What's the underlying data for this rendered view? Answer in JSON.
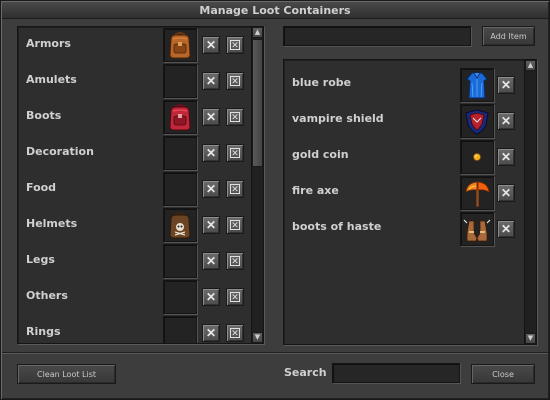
{
  "window": {
    "title": "Manage Loot Containers"
  },
  "categories": [
    {
      "label": "Armors",
      "container": "orange-backpack"
    },
    {
      "label": "Amulets",
      "container": ""
    },
    {
      "label": "Boots",
      "container": "red-backpack"
    },
    {
      "label": "Decoration",
      "container": ""
    },
    {
      "label": "Food",
      "container": ""
    },
    {
      "label": "Helmets",
      "container": "pirate-backpack"
    },
    {
      "label": "Legs",
      "container": ""
    },
    {
      "label": "Others",
      "container": ""
    },
    {
      "label": "Rings",
      "container": ""
    }
  ],
  "top": {
    "item_input_value": "",
    "add_item_label": "Add Item"
  },
  "loot_items": [
    {
      "label": "blue robe",
      "icon": "blue-robe-icon"
    },
    {
      "label": "vampire shield",
      "icon": "vampire-shield-icon"
    },
    {
      "label": "gold coin",
      "icon": "gold-coin-icon"
    },
    {
      "label": "fire axe",
      "icon": "fire-axe-icon"
    },
    {
      "label": "boots of haste",
      "icon": "boots-of-haste-icon"
    }
  ],
  "bottom": {
    "clean_label": "Clean Loot List",
    "search_label": "Search",
    "search_value": "",
    "close_label": "Close"
  },
  "colors": {
    "window_bg": "#3d3d3d",
    "panel_bg": "#2e2e2e",
    "text": "#d0d0d0"
  }
}
